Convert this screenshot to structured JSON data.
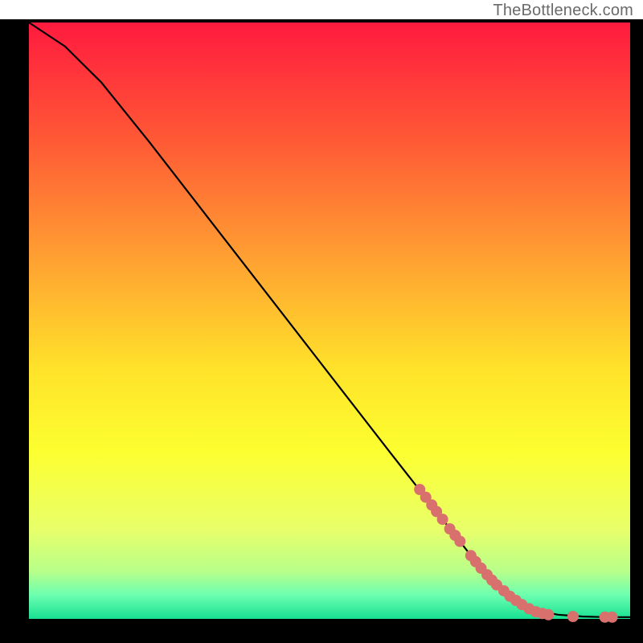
{
  "attribution": "TheBottleneck.com",
  "chart_data": {
    "type": "line",
    "title": "",
    "xlabel": "",
    "ylabel": "",
    "xlim": [
      0,
      100
    ],
    "ylim": [
      0,
      100
    ],
    "curve": [
      {
        "x": 0,
        "y": 100
      },
      {
        "x": 6,
        "y": 96
      },
      {
        "x": 12,
        "y": 90
      },
      {
        "x": 20,
        "y": 80
      },
      {
        "x": 30,
        "y": 67
      },
      {
        "x": 40,
        "y": 54
      },
      {
        "x": 50,
        "y": 41
      },
      {
        "x": 60,
        "y": 28
      },
      {
        "x": 67,
        "y": 19
      },
      {
        "x": 74,
        "y": 10
      },
      {
        "x": 80,
        "y": 4
      },
      {
        "x": 84,
        "y": 1.5
      },
      {
        "x": 88,
        "y": 0.7
      },
      {
        "x": 92,
        "y": 0.4
      },
      {
        "x": 96,
        "y": 0.3
      },
      {
        "x": 100,
        "y": 0.3
      }
    ],
    "markers": [
      {
        "x": 65.0,
        "y": 21.7
      },
      {
        "x": 66.0,
        "y": 20.4
      },
      {
        "x": 67.0,
        "y": 19.1
      },
      {
        "x": 67.8,
        "y": 18.0
      },
      {
        "x": 68.8,
        "y": 16.7
      },
      {
        "x": 70.0,
        "y": 15.1
      },
      {
        "x": 70.9,
        "y": 14.0
      },
      {
        "x": 71.7,
        "y": 13.0
      },
      {
        "x": 73.5,
        "y": 10.6
      },
      {
        "x": 74.3,
        "y": 9.6
      },
      {
        "x": 75.2,
        "y": 8.5
      },
      {
        "x": 76.2,
        "y": 7.4
      },
      {
        "x": 77.0,
        "y": 6.5
      },
      {
        "x": 77.8,
        "y": 5.7
      },
      {
        "x": 79.0,
        "y": 4.7
      },
      {
        "x": 80.0,
        "y": 3.8
      },
      {
        "x": 81.0,
        "y": 3.1
      },
      {
        "x": 82.0,
        "y": 2.4
      },
      {
        "x": 83.2,
        "y": 1.7
      },
      {
        "x": 84.3,
        "y": 1.2
      },
      {
        "x": 85.4,
        "y": 0.9
      },
      {
        "x": 86.4,
        "y": 0.7
      },
      {
        "x": 90.5,
        "y": 0.4
      },
      {
        "x": 95.8,
        "y": 0.3
      },
      {
        "x": 97.0,
        "y": 0.3
      }
    ],
    "gradient_stops": [
      {
        "pct": 0,
        "color": "#ff1a3f"
      },
      {
        "pct": 20,
        "color": "#ff5a35"
      },
      {
        "pct": 40,
        "color": "#ffa232"
      },
      {
        "pct": 58,
        "color": "#ffe22a"
      },
      {
        "pct": 72,
        "color": "#fcff30"
      },
      {
        "pct": 85,
        "color": "#e8ff6a"
      },
      {
        "pct": 92,
        "color": "#b8ff8a"
      },
      {
        "pct": 96,
        "color": "#6cffb0"
      },
      {
        "pct": 100,
        "color": "#18e093"
      }
    ],
    "marker_color": "#d8706d",
    "frame_color": "#000000"
  }
}
